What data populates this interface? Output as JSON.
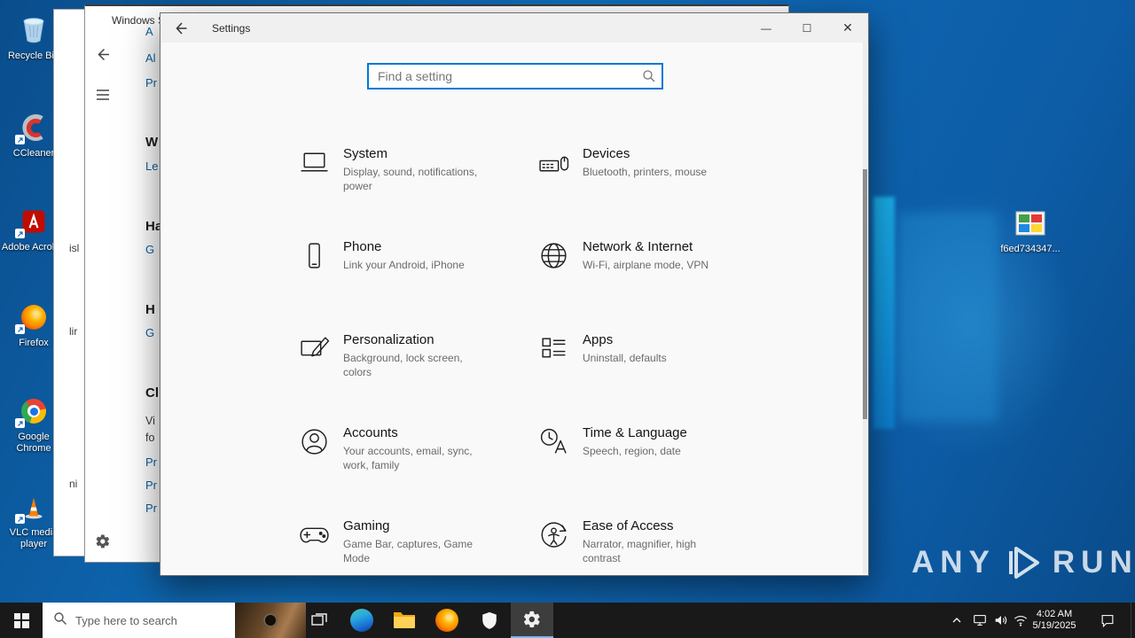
{
  "desktop": {
    "icons": [
      {
        "label": "Recycle Bin"
      },
      {
        "label": "CCleaner"
      },
      {
        "label": "Adobe Acrobat"
      },
      {
        "label": "Firefox"
      },
      {
        "label": "Google Chrome"
      },
      {
        "label": "VLC media player"
      }
    ],
    "file_icon": {
      "label": "f6ed734347..."
    },
    "watermark": {
      "left": "ANY",
      "right": "RUN"
    }
  },
  "security_window": {
    "title": "Windows Secu",
    "fragments": [
      {
        "text": "A"
      },
      {
        "text": "Al"
      },
      {
        "text": "Pr"
      },
      {
        "text": "W"
      },
      {
        "text": "Le"
      },
      {
        "text": "Ha"
      },
      {
        "text": "G"
      },
      {
        "text": "H"
      },
      {
        "text": "G"
      },
      {
        "text": "Cl"
      },
      {
        "text": "Vi"
      },
      {
        "text": "fo"
      },
      {
        "text": "Pr"
      },
      {
        "text": "Pr"
      },
      {
        "text": "Pr"
      }
    ],
    "strip_fragments": [
      {
        "text": "isl"
      },
      {
        "text": "lir"
      },
      {
        "text": "ni"
      }
    ]
  },
  "settings": {
    "window_title": "Settings",
    "search_placeholder": "Find a setting",
    "window_controls": {
      "minimize": "—",
      "maximize": "☐",
      "close": "✕"
    },
    "categories": [
      {
        "name": "System",
        "desc": "Display, sound, notifications, power"
      },
      {
        "name": "Devices",
        "desc": "Bluetooth, printers, mouse"
      },
      {
        "name": "Phone",
        "desc": "Link your Android, iPhone"
      },
      {
        "name": "Network & Internet",
        "desc": "Wi-Fi, airplane mode, VPN"
      },
      {
        "name": "Personalization",
        "desc": "Background, lock screen, colors"
      },
      {
        "name": "Apps",
        "desc": "Uninstall, defaults"
      },
      {
        "name": "Accounts",
        "desc": "Your accounts, email, sync, work, family"
      },
      {
        "name": "Time & Language",
        "desc": "Speech, region, date"
      },
      {
        "name": "Gaming",
        "desc": "Game Bar, captures, Game Mode"
      },
      {
        "name": "Ease of Access",
        "desc": "Narrator, magnifier, high contrast"
      }
    ]
  },
  "taskbar": {
    "search_placeholder": "Type here to search",
    "clock": {
      "time": "4:02 AM",
      "date": "5/19/2025"
    }
  },
  "colors": {
    "accent": "#0078d7",
    "link": "#0b62a4",
    "taskbar": "#191919"
  }
}
